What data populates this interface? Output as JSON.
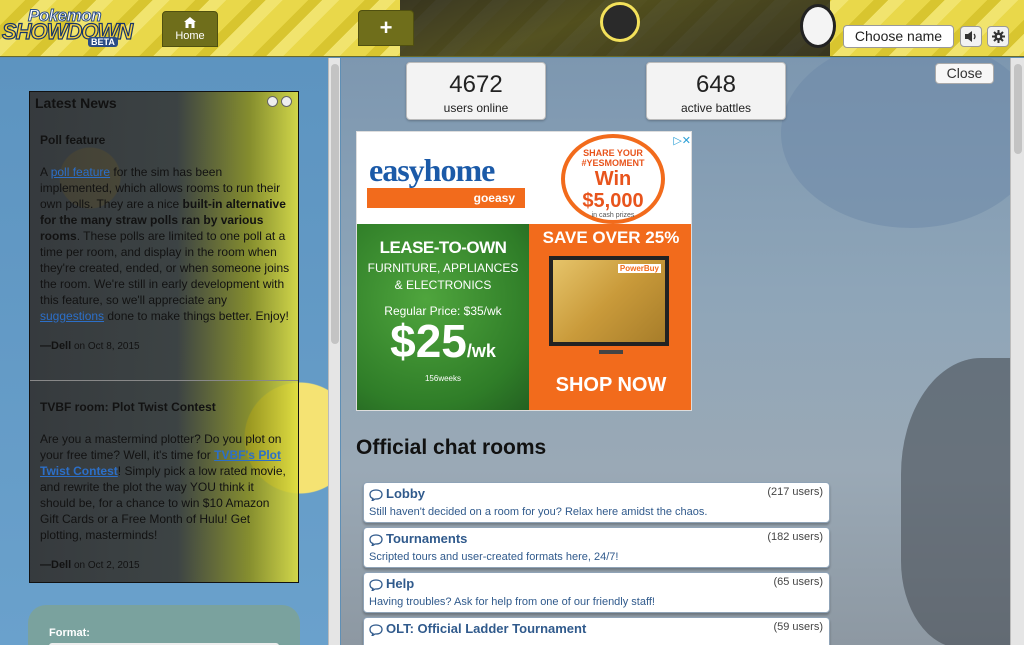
{
  "header": {
    "logo": {
      "line1": "Pokemon",
      "line2": "SHOWDOWN",
      "badge": "BETA"
    },
    "home_tab_label": "Home",
    "add_tab_label": "+",
    "user_button_label": "Choose name"
  },
  "news": {
    "title": "Latest News",
    "articles": [
      {
        "title": "Poll feature",
        "body_intro": "A ",
        "link1": "poll feature",
        "body_mid": " for the sim has been implemented, which allows rooms to run their own polls. They are a nice ",
        "bold": "built-in alternative for the many straw polls ran by various rooms",
        "body_rest": ". These polls are limited to one poll at a time per room, and display in the room when they're created, ended, or when someone joins the room. We're still in early development with this feature, so we'll appreciate any ",
        "link2": "suggestions",
        "body_end": " done to make things better. Enjoy!",
        "author": "—Dell",
        "date": "on Oct 8, 2015"
      },
      {
        "title": "TVBF room: Plot Twist Contest",
        "body_intro": "Are you a mastermind plotter? Do you plot on your free time? Well, it's time for ",
        "link1": "TVBF's Plot Twist Contest",
        "body_rest": "! Simply pick a low rated movie, and rewrite the plot the way YOU think it should be, for a chance to win $10 Amazon Gift Cards or a Free Month of Hulu! Get plotting, masterminds!",
        "author": "—Dell",
        "date": "on Oct 2, 2015"
      }
    ]
  },
  "format": {
    "label": "Format:"
  },
  "stats": {
    "users_online": "4672",
    "users_online_label": "users online",
    "active_battles": "648",
    "active_battles_label": "active battles"
  },
  "close_label": "Close",
  "ad": {
    "brand": "easyhome",
    "tagline": "goeasy",
    "badge_line1": "SHARE YOUR #YESMOMENT",
    "badge_line2": "Win $5,000",
    "badge_line3": "in cash prizes",
    "left_title": "LEASE-TO-OWN",
    "left_sub1": "FURNITURE, APPLIANCES",
    "left_sub2": "& ELECTRONICS",
    "regular_price": "Regular Price: $35/wk",
    "price": "$25",
    "price_unit": "/wk",
    "weeks": "156weeks",
    "right_title": "SAVE OVER 25%",
    "tv_brand": "PowerBuy",
    "cta": "SHOP NOW"
  },
  "rooms": {
    "title": "Official chat rooms",
    "items": [
      {
        "name": "Lobby",
        "count": "(217 users)",
        "desc": "Still haven't decided on a room for you? Relax here amidst the chaos."
      },
      {
        "name": "Tournaments",
        "count": "(182 users)",
        "desc": "Scripted tours and user-created formats here, 24/7!"
      },
      {
        "name": "Help",
        "count": "(65 users)",
        "desc": "Having troubles? Ask for help from one of our friendly staff!"
      },
      {
        "name": "OLT: Official Ladder Tournament",
        "count": "(59 users)",
        "desc": ""
      }
    ]
  },
  "colors": {
    "header": "#e9d84a",
    "tab": "#6f6e1b",
    "room_link": "#305a8c",
    "ad_orange": "#f26b1c",
    "ad_green": "#2f7d28"
  }
}
